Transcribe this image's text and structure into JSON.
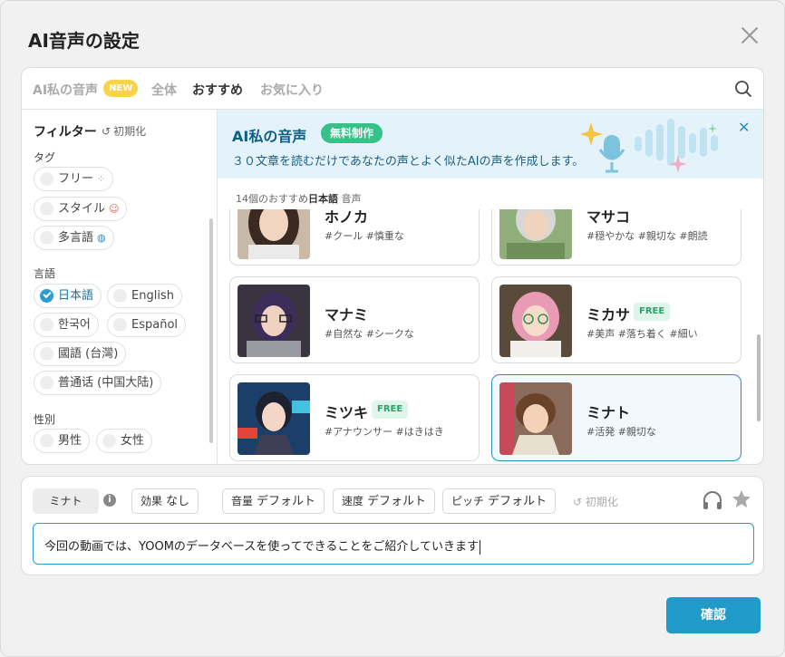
{
  "dialog": {
    "title": "AI音声の設定",
    "confirm_label": "確認"
  },
  "tabs": [
    {
      "label": "AI私の音声",
      "badge": "NEW"
    },
    {
      "label": "全体"
    },
    {
      "label": "おすすめ"
    },
    {
      "label": "お気に入り"
    }
  ],
  "filters": {
    "title": "フィルター",
    "reset": "初期化",
    "tag_heading": "タグ",
    "tags": [
      "フリー",
      "スタイル",
      "多言語"
    ],
    "language_heading": "言語",
    "languages": [
      "日本語",
      "English",
      "한국어",
      "Español",
      "國語 (台灣)",
      "普通话 (中国大陆)"
    ],
    "gender_heading": "性別",
    "genders": [
      "男性",
      "女性"
    ]
  },
  "banner": {
    "title": "AI私の音声",
    "pill": "無料制作",
    "description": "３０文章を読むだけであなたの声とよく似たAIの声を作成します。"
  },
  "list": {
    "count_prefix": "14個のおすすめ",
    "count_lang": "日本語",
    "count_suffix": " 音声",
    "voices": [
      {
        "name": "ホノカ",
        "tags": "#クール #慎重な"
      },
      {
        "name": "マサコ",
        "tags": "#穏やかな #親切な #朗読"
      },
      {
        "name": "マナミ",
        "tags": "#自然な #シークな"
      },
      {
        "name": "ミカサ",
        "badge": "FREE",
        "tags": "#美声 #落ち着く #細い"
      },
      {
        "name": "ミツキ",
        "badge": "FREE",
        "tags": "#アナウンサー #はきはき"
      },
      {
        "name": "ミナト",
        "tags": "#活発 #親切な"
      }
    ]
  },
  "panel": {
    "speaker": "ミナト",
    "effect_key": "効果",
    "effect_val": "なし",
    "volume_key": "音量",
    "volume_val": "デフォルト",
    "speed_key": "速度",
    "speed_val": "デフォルト",
    "pitch_key": "ピッチ",
    "pitch_val": "デフォルト",
    "reset": "初期化",
    "text": "今回の動画では、YOOMのデータベースを使ってできることをご紹介していきます"
  },
  "colors": {
    "accent": "#1f9ac9",
    "free_green": "#36c18a",
    "new_yellow": "#f7d24a"
  }
}
